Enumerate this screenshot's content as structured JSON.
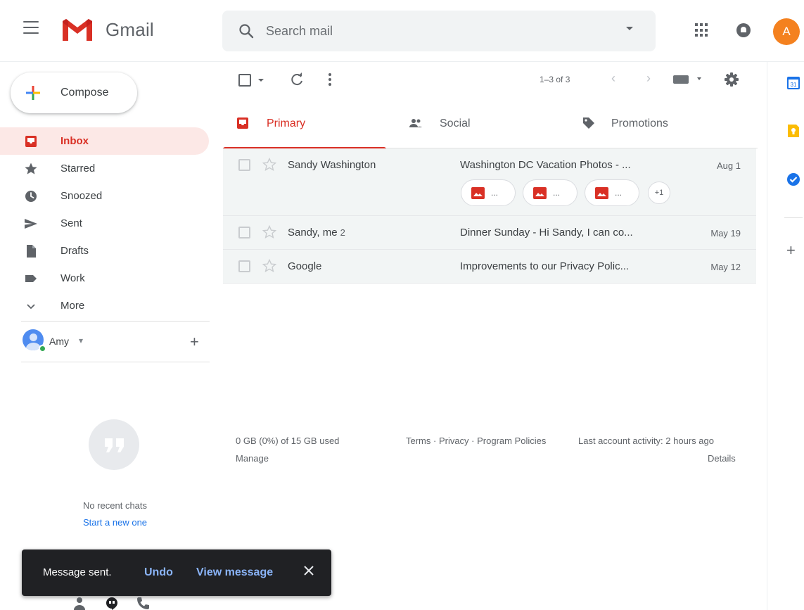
{
  "header": {
    "brand": "Gmail",
    "search_placeholder": "Search mail",
    "avatar_initial": "A",
    "accent_color": "#d93025"
  },
  "sidebar": {
    "compose_label": "Compose",
    "items": [
      {
        "label": "Inbox",
        "icon": "inbox-icon",
        "active": true
      },
      {
        "label": "Starred",
        "icon": "star-icon"
      },
      {
        "label": "Snoozed",
        "icon": "clock-icon"
      },
      {
        "label": "Sent",
        "icon": "send-icon"
      },
      {
        "label": "Drafts",
        "icon": "draft-icon"
      },
      {
        "label": "Work",
        "icon": "label-icon"
      },
      {
        "label": "More",
        "icon": "chevron-down-icon"
      }
    ]
  },
  "hangouts": {
    "user_name": "Amy",
    "caret": "▾",
    "no_chats": "No recent chats",
    "start_new": "Start a new one"
  },
  "toolbar": {
    "page_count": "1–3 of 3"
  },
  "tabs": [
    {
      "label": "Primary",
      "icon": "inbox-icon",
      "active": true
    },
    {
      "label": "Social",
      "icon": "people-icon"
    },
    {
      "label": "Promotions",
      "icon": "tag-icon"
    }
  ],
  "emails": [
    {
      "sender": "Sandy Washington",
      "count": "",
      "subject": "Washington DC Vacation Photos - ...",
      "date": "Aug 1",
      "attachments": [
        "...",
        "...",
        "..."
      ],
      "more_attachments": "+1"
    },
    {
      "sender": "Sandy, me",
      "count": "2",
      "subject": "Dinner Sunday - Hi Sandy, I can co...",
      "date": "May 19"
    },
    {
      "sender": "Google",
      "count": "",
      "subject": "Improvements to our Privacy Polic...",
      "date": "May 12"
    }
  ],
  "footer": {
    "storage": "0 GB (0%) of 15 GB used",
    "manage": "Manage",
    "links": "Terms · Privacy · Program Policies",
    "activity": "Last account activity: 2 hours ago",
    "details": "Details"
  },
  "snackbar": {
    "message": "Message sent.",
    "undo": "Undo",
    "view": "View message"
  },
  "side_panel": {
    "calendar_day": "31"
  }
}
